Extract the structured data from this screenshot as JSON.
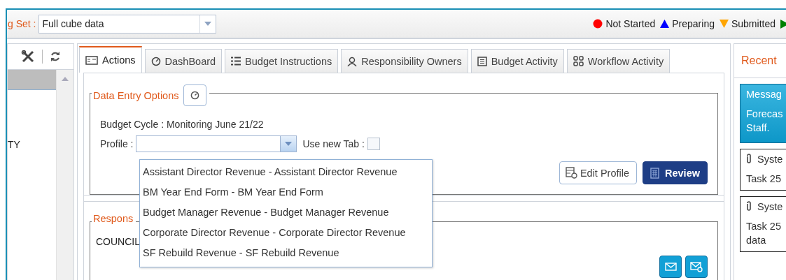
{
  "toolbar": {
    "label": "g Set :",
    "select_value": "Full cube data"
  },
  "legend": [
    {
      "kind": "circle",
      "label": "Not Started",
      "color": "#ff0000"
    },
    {
      "kind": "up",
      "label": "Preparing",
      "color": "#0000ff"
    },
    {
      "kind": "down",
      "label": "Submitted",
      "color": "#ffa500"
    },
    {
      "kind": "right",
      "color": "#008000"
    }
  ],
  "left_panel": {
    "row_text": "TY"
  },
  "tabs": [
    {
      "kind": "actions",
      "label": "Actions",
      "selected": true
    },
    {
      "kind": "dashboard",
      "label": "DashBoard",
      "selected": false
    },
    {
      "kind": "list",
      "label": "Budget Instructions",
      "selected": false
    },
    {
      "kind": "person",
      "label": "Responsibility Owners",
      "selected": false
    },
    {
      "kind": "document",
      "label": "Budget Activity",
      "selected": false
    },
    {
      "kind": "workflow",
      "label": "Workflow Activity",
      "selected": false
    }
  ],
  "data_entry": {
    "legend": "Data Entry Options",
    "budget_cycle": "Budget Cycle : Monitoring June 21/22",
    "profile_label": "Profile :",
    "use_new_tab_label": "Use new Tab :",
    "use_new_tab_checked": false,
    "edit_button": "Edit Profile",
    "review_button": "Review"
  },
  "profile_dropdown": {
    "options": [
      "Assistant Director Revenue - Assistant Director Revenue",
      "BM Year End Form - BM Year End Form",
      "Budget Manager Revenue - Budget Manager Revenue",
      "Corporate Director Revenue - Corporate Director Revenue",
      "SF Rebuild Revenue - SF Rebuild Revenue"
    ]
  },
  "responsibility": {
    "legend": "Respons",
    "text": "COUNCIL"
  },
  "recent": {
    "title": "Recent",
    "cards": [
      {
        "kind": "message",
        "title": "Messag",
        "lines": [
          "Forecas",
          "Staff."
        ]
      },
      {
        "kind": "task",
        "title": "Syste",
        "lines": [
          "Task 25"
        ]
      },
      {
        "kind": "task",
        "title": "Syste",
        "lines": [
          "Task 25",
          "data"
        ]
      }
    ]
  }
}
